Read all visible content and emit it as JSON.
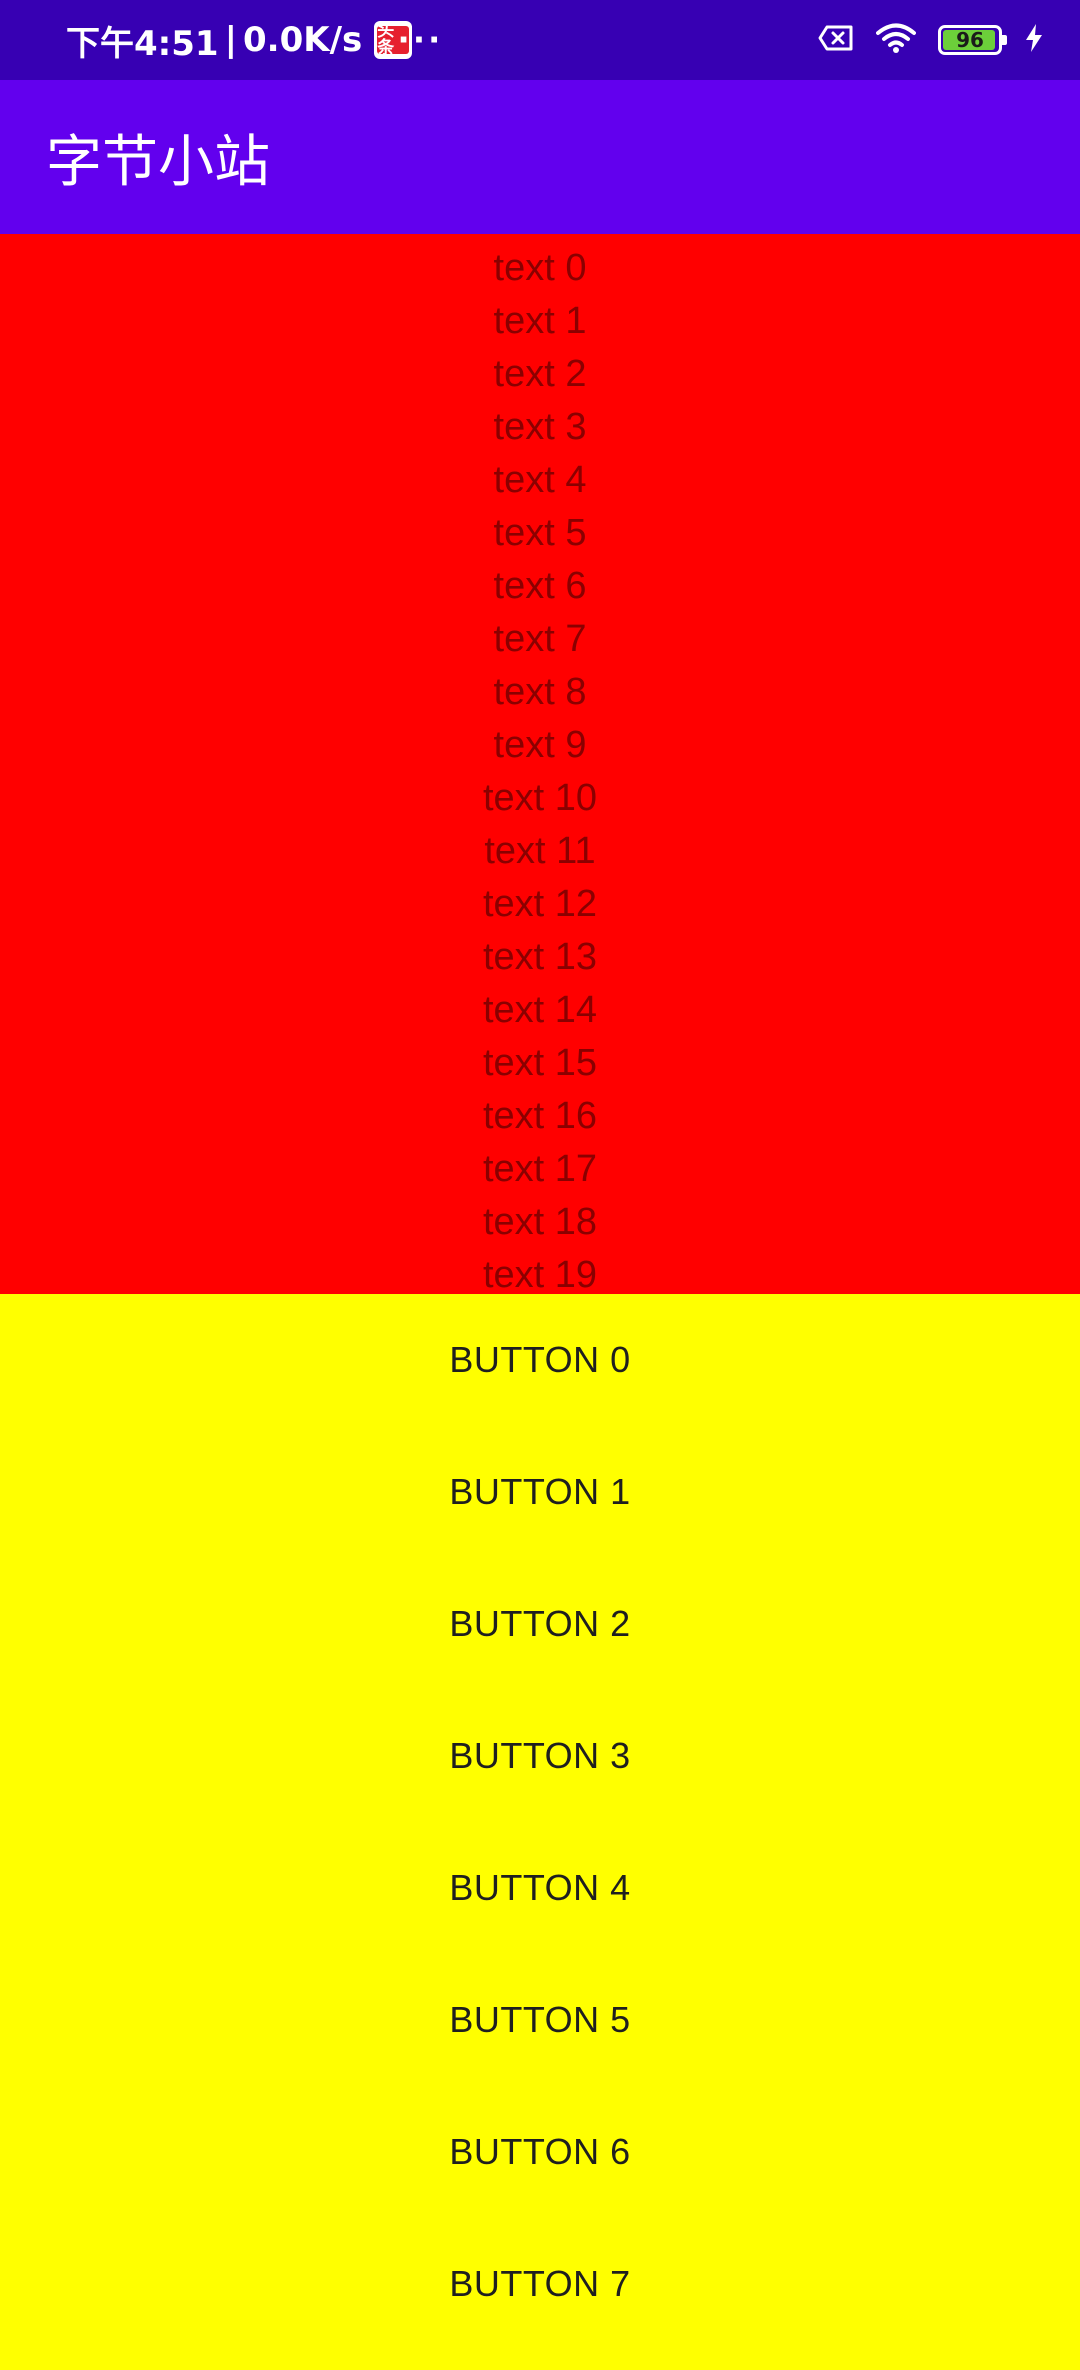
{
  "status_bar": {
    "time": "下午4:51",
    "separator": "|",
    "net_speed": "0.0K/s",
    "app_badge": "头条",
    "more": "···",
    "battery_level": "96",
    "battery_fraction": 0.96,
    "icons": [
      "close-box-icon",
      "wifi-icon",
      "battery-icon",
      "charging-bolt-icon"
    ]
  },
  "app_bar": {
    "title": "字节小站"
  },
  "text_list": [
    "text 0",
    "text 1",
    "text 2",
    "text 3",
    "text 4",
    "text 5",
    "text 6",
    "text 7",
    "text 8",
    "text 9",
    "text 10",
    "text 11",
    "text 12",
    "text 13",
    "text 14",
    "text 15",
    "text 16",
    "text 17",
    "text 18",
    "text 19"
  ],
  "buttons": [
    "BUTTON 0",
    "BUTTON 1",
    "BUTTON 2",
    "BUTTON 3",
    "BUTTON 4",
    "BUTTON 5",
    "BUTTON 6",
    "BUTTON 7"
  ],
  "colors": {
    "status_bar": "#3700b3",
    "app_bar": "#6200ee",
    "text_area": "#ff0000",
    "button_area": "#ffff00"
  }
}
